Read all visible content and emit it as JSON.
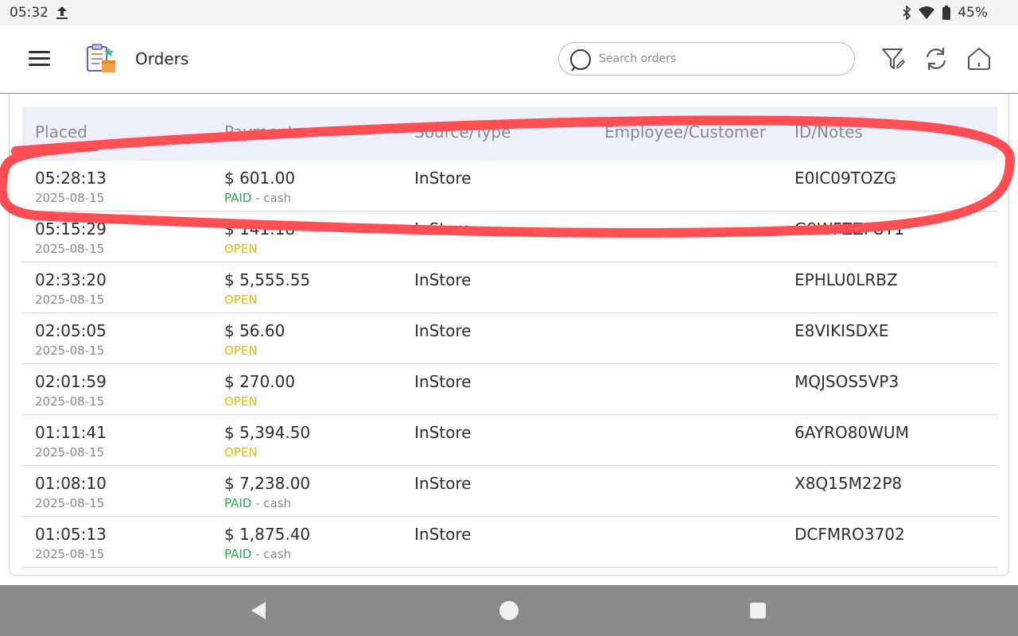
{
  "status_bar": {
    "time": "05:32",
    "battery": "45%"
  },
  "app_bar": {
    "title": "Orders",
    "search_placeholder": "Search orders"
  },
  "table": {
    "columns": [
      "Placed",
      "Payment",
      "Source/Type",
      "Employee/Customer",
      "ID/Notes"
    ],
    "rows": [
      {
        "time": "05:28:13",
        "date": "2025-08-15",
        "amount": "$ 601.00",
        "status": "PAID",
        "method": "- cash",
        "source": "InStore",
        "employee": "",
        "id": "E0IC09TOZG"
      },
      {
        "time": "05:15:29",
        "date": "2025-08-15",
        "amount": "$ 141.18",
        "status": "OPEN",
        "method": "",
        "source": "InStore",
        "employee": "",
        "id": "G9WFZZFUY1"
      },
      {
        "time": "02:33:20",
        "date": "2025-08-15",
        "amount": "$ 5,555.55",
        "status": "OPEN",
        "method": "",
        "source": "InStore",
        "employee": "",
        "id": "EPHLU0LRBZ"
      },
      {
        "time": "02:05:05",
        "date": "2025-08-15",
        "amount": "$ 56.60",
        "status": "OPEN",
        "method": "",
        "source": "InStore",
        "employee": "",
        "id": "E8VIKISDXE"
      },
      {
        "time": "02:01:59",
        "date": "2025-08-15",
        "amount": "$ 270.00",
        "status": "OPEN",
        "method": "",
        "source": "InStore",
        "employee": "",
        "id": "MQJSOS5VP3"
      },
      {
        "time": "01:11:41",
        "date": "2025-08-15",
        "amount": "$ 5,394.50",
        "status": "OPEN",
        "method": "",
        "source": "InStore",
        "employee": "",
        "id": "6AYRO80WUM"
      },
      {
        "time": "01:08:10",
        "date": "2025-08-15",
        "amount": "$ 7,238.00",
        "status": "PAID",
        "method": "- cash",
        "source": "InStore",
        "employee": "",
        "id": "X8Q15M22P8"
      },
      {
        "time": "01:05:13",
        "date": "2025-08-15",
        "amount": "$ 1,875.40",
        "status": "PAID",
        "method": "- cash",
        "source": "InStore",
        "employee": "",
        "id": "DCFMRO3702"
      }
    ]
  },
  "colors": {
    "open": "#e5b800",
    "paid": "#2fa84f",
    "annotation": "#ff4f55",
    "header_bg": "#edeffa"
  },
  "icons": {
    "menu": "hamburger-menu-icon",
    "logo": "orders-clipboard-icon",
    "search": "search-icon",
    "filter": "filter-edit-icon",
    "refresh": "refresh-icon",
    "home": "home-icon",
    "bluetooth": "bluetooth-icon",
    "wifi": "wifi-icon",
    "battery": "battery-icon",
    "upload": "upload-icon"
  }
}
